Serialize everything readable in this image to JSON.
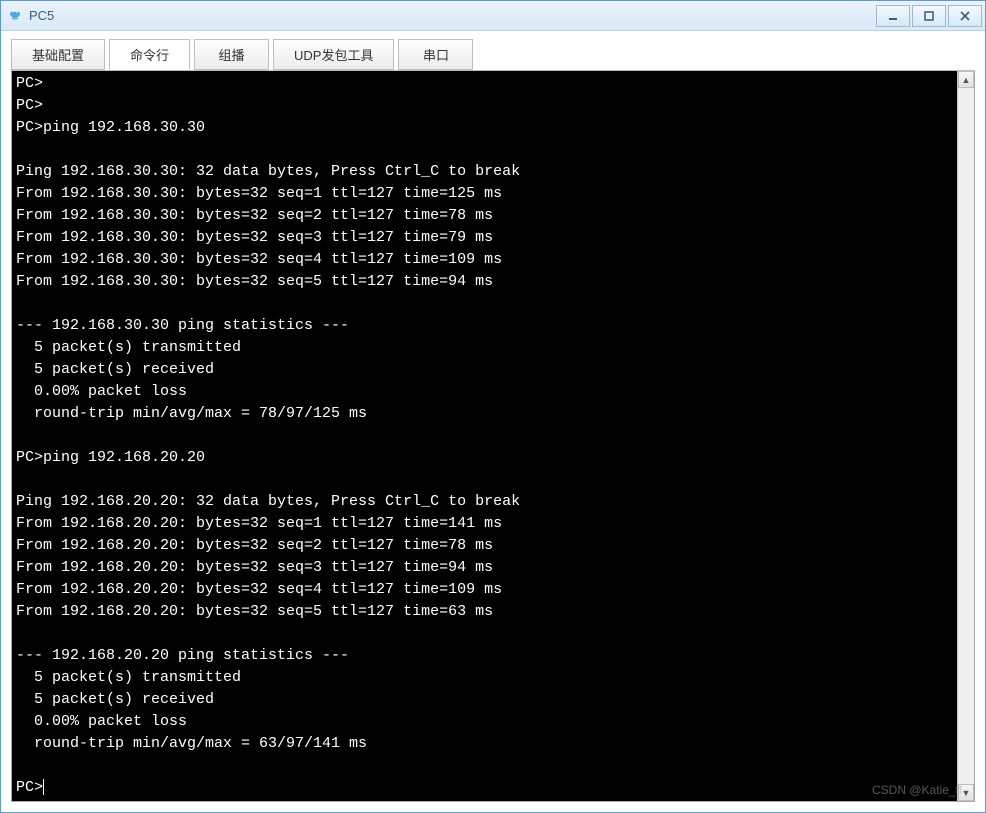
{
  "window": {
    "title": "PC5"
  },
  "tabs": [
    {
      "label": "基础配置"
    },
    {
      "label": "命令行"
    },
    {
      "label": "组播"
    },
    {
      "label": "UDP发包工具"
    },
    {
      "label": "串口"
    }
  ],
  "terminal": {
    "lines": [
      "PC>",
      "PC>",
      "PC>ping 192.168.30.30",
      "",
      "Ping 192.168.30.30: 32 data bytes, Press Ctrl_C to break",
      "From 192.168.30.30: bytes=32 seq=1 ttl=127 time=125 ms",
      "From 192.168.30.30: bytes=32 seq=2 ttl=127 time=78 ms",
      "From 192.168.30.30: bytes=32 seq=3 ttl=127 time=79 ms",
      "From 192.168.30.30: bytes=32 seq=4 ttl=127 time=109 ms",
      "From 192.168.30.30: bytes=32 seq=5 ttl=127 time=94 ms",
      "",
      "--- 192.168.30.30 ping statistics ---",
      "  5 packet(s) transmitted",
      "  5 packet(s) received",
      "  0.00% packet loss",
      "  round-trip min/avg/max = 78/97/125 ms",
      "",
      "PC>ping 192.168.20.20",
      "",
      "Ping 192.168.20.20: 32 data bytes, Press Ctrl_C to break",
      "From 192.168.20.20: bytes=32 seq=1 ttl=127 time=141 ms",
      "From 192.168.20.20: bytes=32 seq=2 ttl=127 time=78 ms",
      "From 192.168.20.20: bytes=32 seq=3 ttl=127 time=94 ms",
      "From 192.168.20.20: bytes=32 seq=4 ttl=127 time=109 ms",
      "From 192.168.20.20: bytes=32 seq=5 ttl=127 time=63 ms",
      "",
      "--- 192.168.20.20 ping statistics ---",
      "  5 packet(s) transmitted",
      "  5 packet(s) received",
      "  0.00% packet loss",
      "  round-trip min/avg/max = 63/97/141 ms",
      "",
      "PC>"
    ],
    "prompt_cursor": true
  },
  "watermark": "CSDN @Katie_ff"
}
